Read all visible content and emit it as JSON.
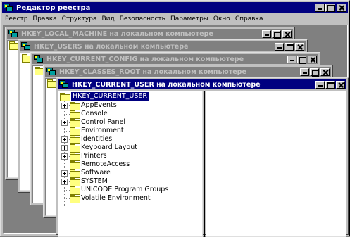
{
  "app": {
    "title": "Редактор реестра",
    "menu": [
      {
        "label": "Реестр"
      },
      {
        "label": "Правка"
      },
      {
        "label": "Структура"
      },
      {
        "label": "Вид"
      },
      {
        "label": "Безопасность"
      },
      {
        "label": "Параметры"
      },
      {
        "label": "Окно"
      },
      {
        "label": "Справка"
      }
    ]
  },
  "windows": [
    {
      "title": "HKEY_LOCAL_MACHINE на локальном компьютере",
      "active": false
    },
    {
      "title": "HKEY_USERS на локальном компьютере",
      "active": false
    },
    {
      "title": "HKEY_CURRENT_CONFIG на локальном компьютере",
      "active": false
    },
    {
      "title": "HKEY_CLASSES_ROOT на локальном компьютере",
      "active": false
    },
    {
      "title": "HKEY_CURRENT_USER на локальном компьютере",
      "active": true
    }
  ],
  "tree": {
    "root": "HKEY_CURRENT_USER",
    "items": [
      {
        "label": "AppEvents",
        "expandable": true
      },
      {
        "label": "Console",
        "expandable": false
      },
      {
        "label": "Control Panel",
        "expandable": true
      },
      {
        "label": "Environment",
        "expandable": false
      },
      {
        "label": "Identities",
        "expandable": true
      },
      {
        "label": "Keyboard Layout",
        "expandable": true
      },
      {
        "label": "Printers",
        "expandable": true
      },
      {
        "label": "RemoteAccess",
        "expandable": false
      },
      {
        "label": "Software",
        "expandable": true
      },
      {
        "label": "SYSTEM",
        "expandable": true
      },
      {
        "label": "UNICODE Program Groups",
        "expandable": false
      },
      {
        "label": "Volatile Environment",
        "expandable": false
      }
    ]
  },
  "colors": {
    "active_title": "#000080",
    "inactive_title": "#808080",
    "face": "#c0c0c0"
  }
}
